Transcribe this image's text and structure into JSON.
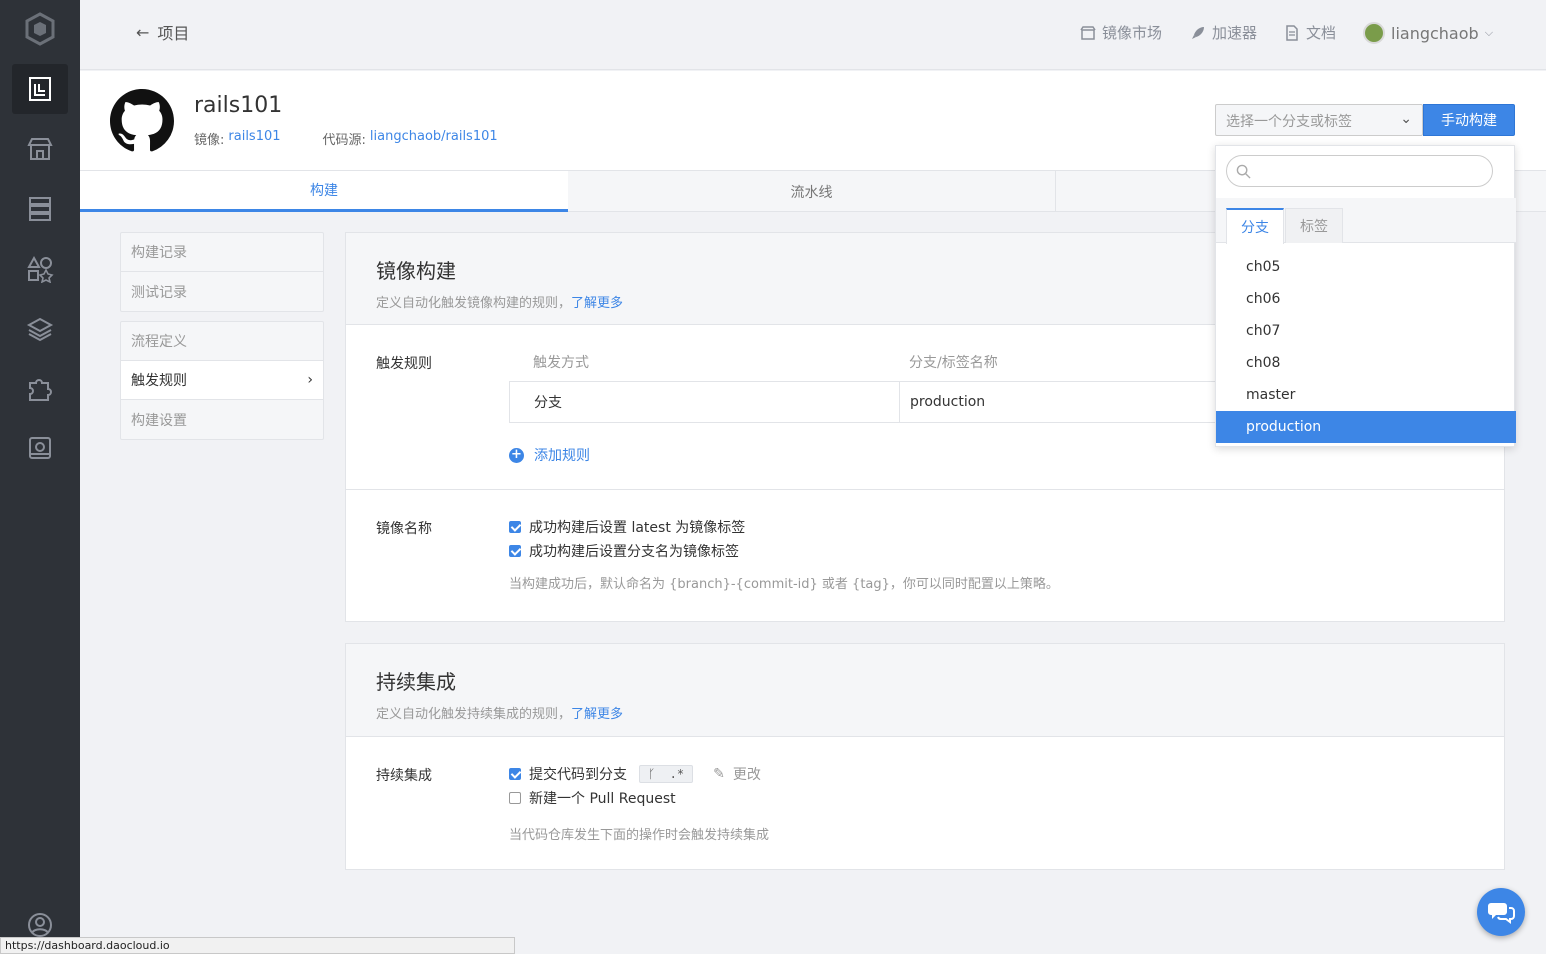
{
  "topbar": {
    "back_label": "项目",
    "nav": [
      {
        "label": "镜像市场",
        "icon": "store-icon"
      },
      {
        "label": "加速器",
        "icon": "rocket-icon"
      },
      {
        "label": "文档",
        "icon": "document-icon"
      }
    ],
    "user": {
      "name": "liangchaob",
      "icon": "user-avatar"
    }
  },
  "header": {
    "project_name": "rails101",
    "image_label": "镜像:",
    "image_value": "rails101",
    "source_label": "代码源:",
    "source_value": "liangchaob/rails101",
    "branch_select_placeholder": "选择一个分支或标签",
    "build_button": "手动构建"
  },
  "tabs": [
    {
      "label": "构建",
      "active": true
    },
    {
      "label": "流水线",
      "active": false
    },
    {
      "label": "",
      "active": false
    }
  ],
  "sidemenu": {
    "group1": [
      "构建记录",
      "测试记录"
    ],
    "group2": [
      "流程定义",
      "触发规则",
      "构建设置"
    ],
    "active": "触发规则"
  },
  "image_build": {
    "title": "镜像构建",
    "desc": "定义自动化触发镜像构建的规则，",
    "learn_more": "了解更多",
    "trigger_label": "触发规则",
    "table_headers": [
      "触发方式",
      "分支/标签名称"
    ],
    "rows": [
      {
        "type": "分支",
        "name": "production"
      }
    ],
    "add_rule": "添加规则",
    "image_name_label": "镜像名称",
    "checks": [
      {
        "label": "成功构建后设置 latest 为镜像标签",
        "checked": true
      },
      {
        "label": "成功构建后设置分支名为镜像标签",
        "checked": true
      }
    ],
    "hint": "当构建成功后，默认命名为 {branch}-{commit-id} 或者 {tag}，你可以同时配置以上策略。"
  },
  "ci": {
    "title": "持续集成",
    "desc": "定义自动化触发持续集成的规则，",
    "learn_more": "了解更多",
    "label": "持续集成",
    "push_label": "提交代码到分支",
    "push_checked": true,
    "branch_pattern": ".*",
    "edit_label": "更改",
    "pr_label": "新建一个 Pull Request",
    "pr_checked": false,
    "hint": "当代码仓库发生下面的操作时会触发持续集成"
  },
  "dropdown": {
    "search_placeholder": "",
    "tabs": [
      "分支",
      "标签"
    ],
    "active_tab": "分支",
    "items": [
      "ch05",
      "ch06",
      "ch07",
      "ch08",
      "master",
      "production"
    ],
    "selected": "production"
  },
  "statusbar": {
    "url": "https://dashboard.daocloud.io"
  },
  "colors": {
    "accent": "#3d86e6",
    "rail": "#2e3238",
    "background": "#f1f2f5"
  }
}
